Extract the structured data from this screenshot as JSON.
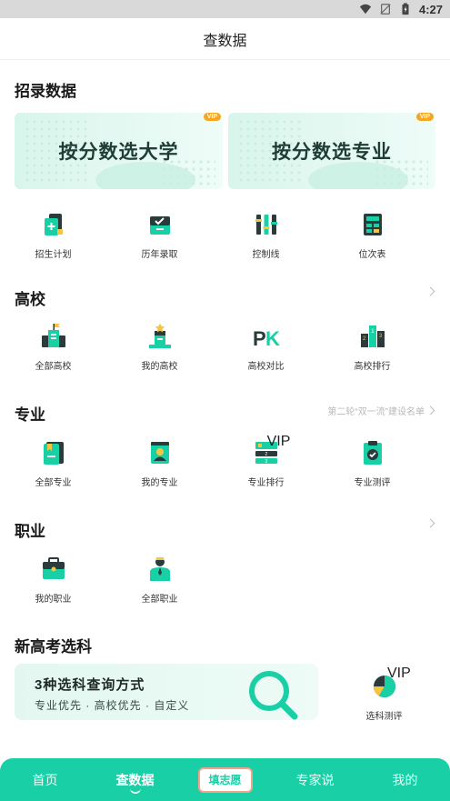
{
  "status_bar": {
    "time": "4:27",
    "icons": [
      "wifi-icon",
      "no-sim-icon",
      "battery-icon"
    ]
  },
  "header": {
    "title": "查数据"
  },
  "admission": {
    "title": "招录数据",
    "banners": [
      {
        "label": "按分数选大学",
        "badge": "VIP"
      },
      {
        "label": "按分数选专业",
        "badge": "VIP"
      }
    ],
    "items": [
      {
        "label": "招生计划",
        "icon": "enrollment-plan-icon"
      },
      {
        "label": "历年录取",
        "icon": "history-admission-icon"
      },
      {
        "label": "控制线",
        "icon": "control-line-icon"
      },
      {
        "label": "位次表",
        "icon": "rank-table-icon"
      }
    ]
  },
  "colleges": {
    "title": "高校",
    "items": [
      {
        "label": "全部高校",
        "icon": "all-colleges-icon"
      },
      {
        "label": "我的高校",
        "icon": "my-college-icon"
      },
      {
        "label": "高校对比",
        "icon": "pk-compare-icon",
        "glyph": "PK"
      },
      {
        "label": "高校排行",
        "icon": "college-ranking-icon"
      }
    ]
  },
  "majors": {
    "title": "专业",
    "more": "第二轮“双一流”建设名单",
    "items": [
      {
        "label": "全部专业",
        "icon": "all-majors-icon"
      },
      {
        "label": "我的专业",
        "icon": "my-major-icon"
      },
      {
        "label": "专业排行",
        "icon": "major-ranking-icon",
        "badge": "VIP"
      },
      {
        "label": "专业测评",
        "icon": "major-assessment-icon"
      }
    ]
  },
  "careers": {
    "title": "职业",
    "items": [
      {
        "label": "我的职业",
        "icon": "my-career-icon"
      },
      {
        "label": "全部职业",
        "icon": "all-careers-icon"
      }
    ]
  },
  "subject_selection": {
    "title": "新高考选科",
    "banner_title": "3种选科查询方式",
    "banner_subtitle": "专业优先 · 高校优先 · 自定义",
    "assessment_label": "选科测评",
    "assessment_badge": "VIP"
  },
  "tabbar": {
    "tabs": [
      {
        "label": "首页"
      },
      {
        "label": "查数据",
        "active": true
      },
      {
        "label": "填志愿",
        "center": true
      },
      {
        "label": "专家说"
      },
      {
        "label": "我的"
      }
    ]
  },
  "colors": {
    "accent": "#18cfa6",
    "accent_dark": "#0f8f72",
    "banner_bg": "#e3f7f0",
    "badge_orange": "#f5a623"
  }
}
